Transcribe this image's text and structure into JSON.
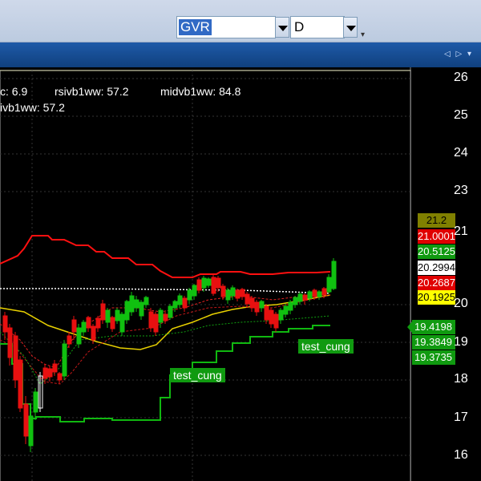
{
  "toolbar": {
    "symbol": "GVR",
    "period": "D"
  },
  "indicator_line1": {
    "c": "c: 6.9",
    "rsi": "rsivb1ww: 57.2",
    "mid": "midvb1ww: 84.8"
  },
  "indicator_line2": "ivb1ww: 57.2",
  "price_labels": [
    {
      "text": "21.2",
      "bg": "#808000",
      "fg": "#000000"
    },
    {
      "text": "21.0001",
      "bg": "#e00000",
      "fg": "#ffffff"
    },
    {
      "text": "20.5125",
      "bg": "#109a10",
      "fg": "#ffffff"
    },
    {
      "text": "20.2994",
      "bg": "#ffffff",
      "fg": "#000000"
    },
    {
      "text": "20.2687",
      "bg": "#e00000",
      "fg": "#ffffff"
    },
    {
      "text": "20.1925",
      "bg": "#ffff00",
      "fg": "#000000"
    }
  ],
  "callout_labels": [
    "19.4198",
    "19.3849",
    "19.3735"
  ],
  "y_ticks": [
    "26",
    "25",
    "24",
    "23",
    "21",
    "20",
    "19",
    "18",
    "17",
    "16"
  ],
  "annotations": {
    "a1": "test_cung",
    "a2": "test_cung"
  },
  "colors": {
    "band": "#ff1010",
    "up": "#10c010",
    "down": "#e81010",
    "ma_yellow": "#e8d000",
    "stop_green": "#10b810"
  }
}
